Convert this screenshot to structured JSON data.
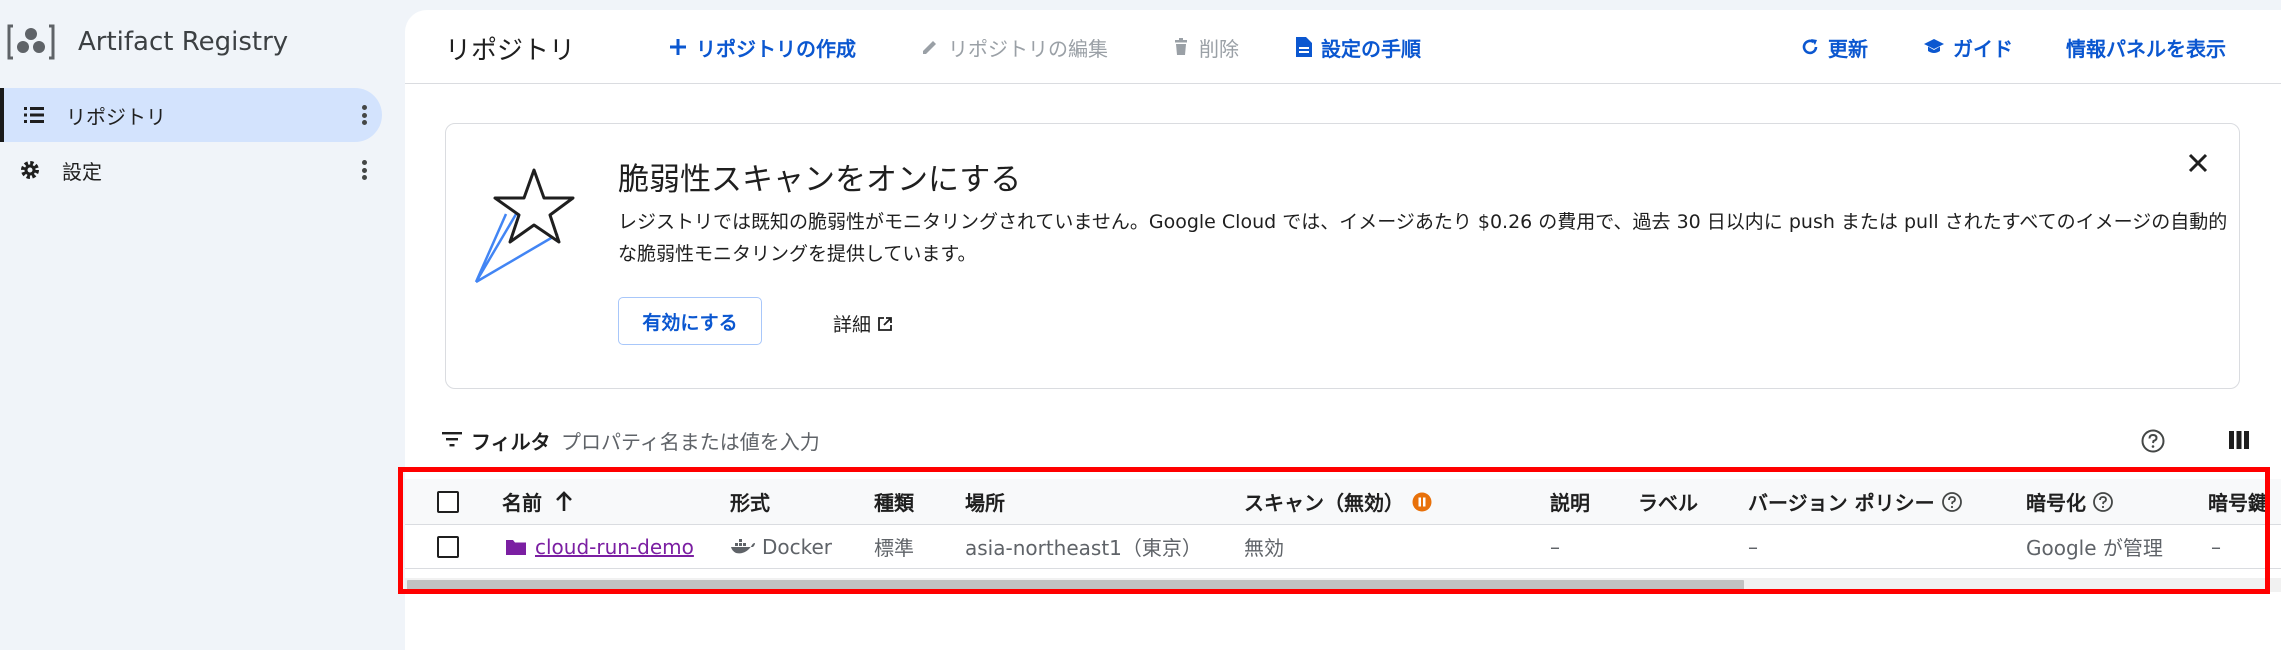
{
  "app": {
    "name": "Artifact Registry"
  },
  "sidebar": {
    "items": [
      {
        "label": "リポジトリ",
        "icon": "list-icon",
        "active": true
      },
      {
        "label": "設定",
        "icon": "gear-icon",
        "active": false
      }
    ]
  },
  "toolbar": {
    "title": "リポジトリ",
    "create_label": "リポジトリの作成",
    "edit_label": "リポジトリの編集",
    "delete_label": "削除",
    "setup_label": "設定の手順",
    "refresh_label": "更新",
    "guide_label": "ガイド",
    "info_panel_label": "情報パネルを表示"
  },
  "banner": {
    "title": "脆弱性スキャンをオンにする",
    "text": "レジストリでは既知の脆弱性がモニタリングされていません。Google Cloud では、イメージあたり $0.26 の費用で、過去 30 日以内に push または pull されたすべてのイメージの自動的な脆弱性モニタリングを提供しています。",
    "enable_label": "有効にする",
    "details_label": "詳細"
  },
  "filter": {
    "label": "フィルタ",
    "placeholder": "プロパティ名または値を入力"
  },
  "table": {
    "headers": {
      "name": "名前",
      "format": "形式",
      "mode": "種類",
      "location": "場所",
      "scan": "スキャン（無効）",
      "description": "説明",
      "labels": "ラベル",
      "version_policy": "バージョン ポリシー",
      "encryption": "暗号化",
      "encryption_key": "暗号鍵"
    },
    "rows": [
      {
        "name": "cloud-run-demo",
        "format": "Docker",
        "mode": "標準",
        "location": "asia-northeast1（東京）",
        "scan": "無効",
        "description": "–",
        "labels": "",
        "version_policy": "–",
        "encryption": "Google が管理",
        "encryption_key": "–"
      }
    ]
  },
  "colors": {
    "accent": "#0b57d0",
    "highlight": "#ff0000",
    "repo_link": "#7b1fa2",
    "scan_paused": "#e8710a"
  }
}
